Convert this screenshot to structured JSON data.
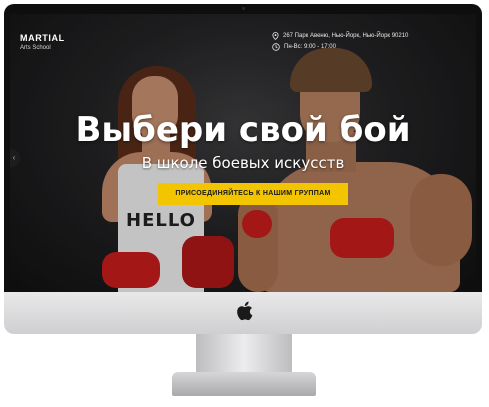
{
  "brand": {
    "name": "MARTIAL",
    "subtitle": "Arts School"
  },
  "contacts": {
    "address": "267 Парк Авеню, Нью-Йорк, Нью-Йорк 90210",
    "hours": "Пн-Вс: 9:00 - 17:00",
    "address_icon": "map-pin-icon",
    "hours_icon": "clock-icon"
  },
  "hero": {
    "title": "Выбери свой бой",
    "subtitle": "В школе боевых искусств",
    "cta_label": "ПРИСОЕДИНЯЙТЕСЬ К НАШИМ ГРУППАМ",
    "shirt_print": "HELLO"
  },
  "nav": {
    "prev_arrow": "‹"
  },
  "colors": {
    "accent": "#f2c500",
    "background": "#1f1f20",
    "text": "#ffffff"
  },
  "device": {
    "logo_icon": "apple-logo-icon"
  }
}
